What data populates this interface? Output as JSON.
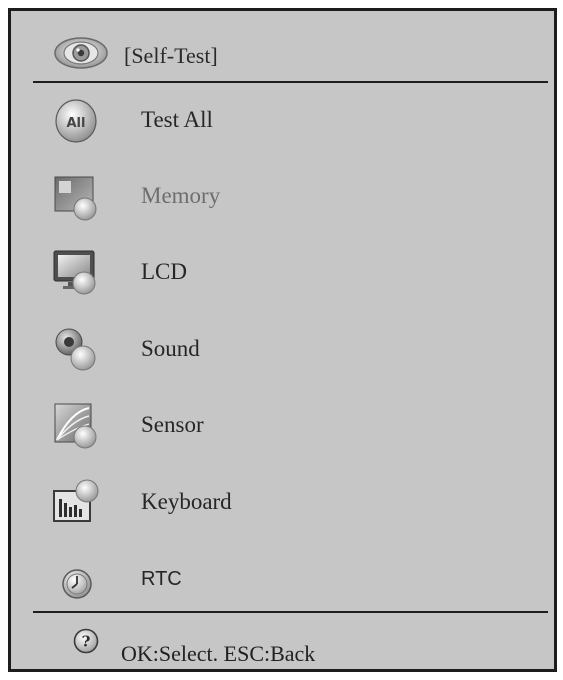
{
  "header": {
    "title": "[Self-Test]",
    "icon": "eye-icon"
  },
  "menu": {
    "items": [
      {
        "label": "Test All",
        "icon": "all-icon"
      },
      {
        "label": "Memory",
        "icon": "memory-icon"
      },
      {
        "label": "LCD",
        "icon": "monitor-icon"
      },
      {
        "label": "Sound",
        "icon": "speaker-icon"
      },
      {
        "label": "Sensor",
        "icon": "sensor-icon"
      },
      {
        "label": "Keyboard",
        "icon": "keyboard-icon"
      },
      {
        "label": "RTC",
        "icon": "clock-icon"
      }
    ]
  },
  "footer": {
    "hint": "OK:Select. ESC:Back",
    "icon": "help-icon"
  },
  "colors": {
    "panel": "#c6c6c6",
    "border": "#1c1c1c",
    "text": "#262626",
    "dim_text": "#6e6e6e"
  }
}
